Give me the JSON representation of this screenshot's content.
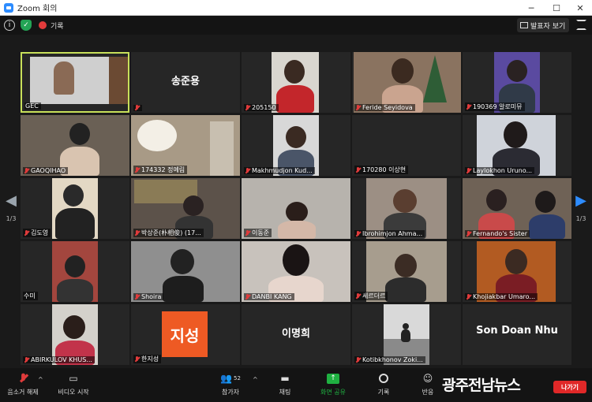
{
  "window": {
    "title": "Zoom 회의"
  },
  "topbar": {
    "record_label": "기록",
    "view_label": "발표자 보기"
  },
  "pagination": {
    "left": "1/3",
    "right": "1/3"
  },
  "participants": [
    {
      "name": "GEC",
      "type": "video"
    },
    {
      "name": "송준용",
      "type": "name"
    },
    {
      "name": "205150",
      "type": "video"
    },
    {
      "name": "Feride Seyidova",
      "type": "video"
    },
    {
      "name": "190369 알로미뮤",
      "type": "video"
    },
    {
      "name": "GAOQIHAO",
      "type": "video"
    },
    {
      "name": "174332 정예림",
      "type": "video"
    },
    {
      "name": "Makhmudjon Kud...",
      "type": "video"
    },
    {
      "name": "170280 이상현",
      "type": "video"
    },
    {
      "name": "Laylokhon Uruno...",
      "type": "video"
    },
    {
      "name": "김도영",
      "type": "video"
    },
    {
      "name": "박상준(朴相俊) (17...",
      "type": "video"
    },
    {
      "name": "이동준",
      "type": "video"
    },
    {
      "name": "Ibrohimjon Ahma...",
      "type": "video"
    },
    {
      "name": "Fernando's Sister",
      "type": "video"
    },
    {
      "name": "수미",
      "type": "video"
    },
    {
      "name": "Shoira",
      "type": "video"
    },
    {
      "name": "DANBI KANG",
      "type": "video"
    },
    {
      "name": "세르더르",
      "type": "video"
    },
    {
      "name": "Khojiakbar Umaro...",
      "type": "video"
    },
    {
      "name": "ABIRKULOV KHUS...",
      "type": "video"
    },
    {
      "name": "한지성",
      "type": "initials",
      "initials": "지성"
    },
    {
      "name": "이명희",
      "type": "name"
    },
    {
      "name": "Kotibkhonov Zoki...",
      "type": "video"
    },
    {
      "name": "Son Doan Nhu",
      "type": "name"
    }
  ],
  "toolbar": {
    "unmute": "음소거 해제",
    "start_video": "비디오 시작",
    "participants": "참가자",
    "participants_count": "52",
    "chat": "채팅",
    "share_screen": "화면 공유",
    "record": "기록",
    "reactions": "반응",
    "leave": "나가기"
  },
  "watermark": "광주전남뉴스",
  "colors": {
    "active_speaker": "#c8e05a",
    "share_green": "#1fb141",
    "leave_red": "#e02828",
    "initials_bg": "#ee5a24"
  }
}
